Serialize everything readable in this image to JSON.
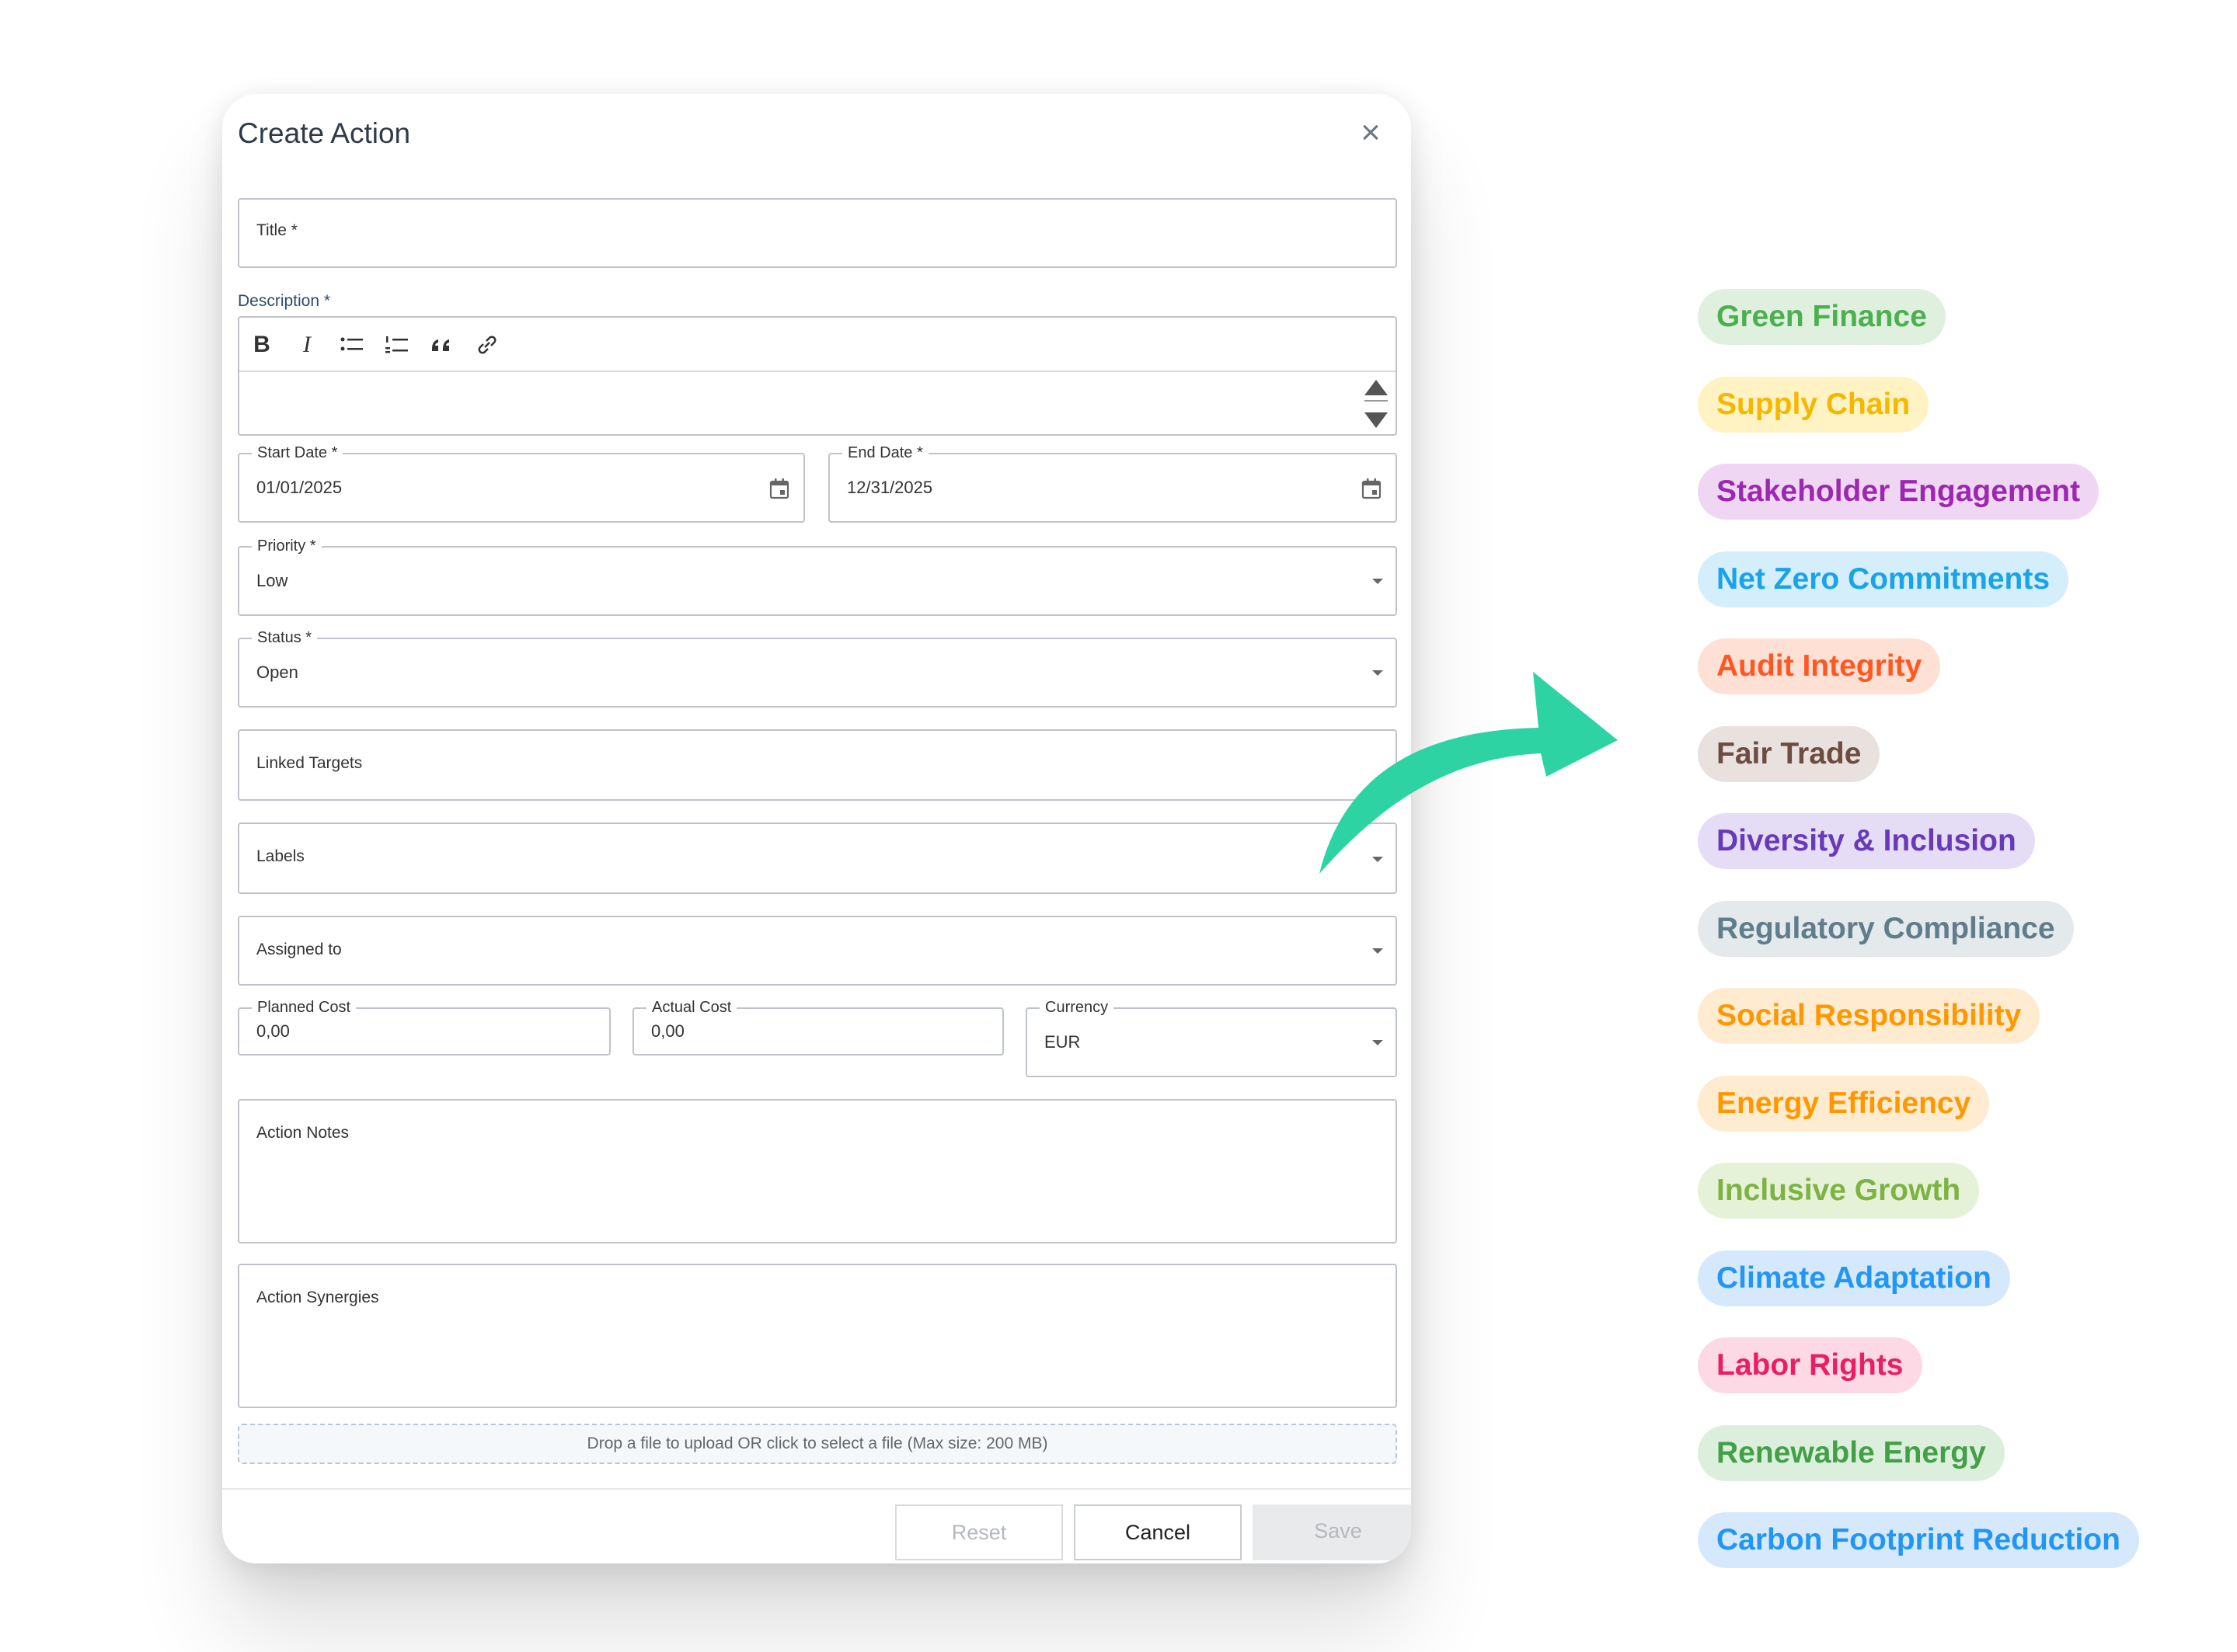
{
  "dialog": {
    "title": "Create Action",
    "title_label": "Title *",
    "description_label": "Description *",
    "start_date": {
      "label": "Start Date *",
      "value": "01/01/2025"
    },
    "end_date": {
      "label": "End Date *",
      "value": "12/31/2025"
    },
    "priority": {
      "label": "Priority *",
      "value": "Low"
    },
    "status": {
      "label": "Status *",
      "value": "Open"
    },
    "linked_targets": "Linked Targets",
    "labels": "Labels",
    "assigned_to": "Assigned to",
    "planned_cost": {
      "label": "Planned Cost",
      "value": "0,00"
    },
    "actual_cost": {
      "label": "Actual Cost",
      "value": "0,00"
    },
    "currency": {
      "label": "Currency",
      "value": "EUR"
    },
    "action_notes": "Action Notes",
    "action_synergies": "Action Synergies",
    "dropzone": "Drop a file to upload OR click to select a file (Max size: 200 MB)",
    "buttons": {
      "reset": "Reset",
      "cancel": "Cancel",
      "save": "Save"
    },
    "toolbar": {
      "bold": "B",
      "italic": "I"
    }
  },
  "tags": [
    {
      "label": "Green Finance",
      "color": "#4caf50",
      "bg": "#dff0df"
    },
    {
      "label": "Supply Chain",
      "color": "#f5b800",
      "bg": "#fff3c4"
    },
    {
      "label": "Stakeholder Engagement",
      "color": "#9c27b0",
      "bg": "#efd7f3"
    },
    {
      "label": "Net Zero Commitments",
      "color": "#1aa3e8",
      "bg": "#d4eefb"
    },
    {
      "label": "Audit Integrity",
      "color": "#ff5722",
      "bg": "#ffe0d5"
    },
    {
      "label": "Fair Trade",
      "color": "#6d4c41",
      "bg": "#e9e1dd"
    },
    {
      "label": "Diversity & Inclusion",
      "color": "#673ab7",
      "bg": "#e5dcf5"
    },
    {
      "label": "Regulatory Compliance",
      "color": "#607d8b",
      "bg": "#e4e9ec"
    },
    {
      "label": "Social Responsibility",
      "color": "#ff9800",
      "bg": "#ffebcf"
    },
    {
      "label": "Energy Efficiency",
      "color": "#ff9800",
      "bg": "#ffebcf"
    },
    {
      "label": "Inclusive Growth",
      "color": "#7cb342",
      "bg": "#e6f2d8"
    },
    {
      "label": "Climate Adaptation",
      "color": "#2196f3",
      "bg": "#d6e9fc"
    },
    {
      "label": "Labor Rights",
      "color": "#e91e63",
      "bg": "#fcd9e5"
    },
    {
      "label": "Renewable Energy",
      "color": "#43a047",
      "bg": "#dcefdc"
    },
    {
      "label": "Carbon Footprint Reduction",
      "color": "#2196f3",
      "bg": "#d6e9fc"
    }
  ],
  "arrow_color": "#2ed3a4"
}
